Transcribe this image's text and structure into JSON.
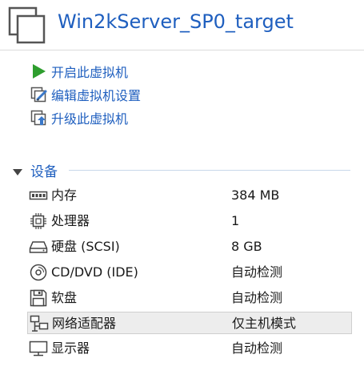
{
  "vm": {
    "title": "Win2kServer_SP0_target"
  },
  "actions": [
    {
      "label": "开启此虚拟机",
      "icon": "play-icon"
    },
    {
      "label": "编辑虚拟机设置",
      "icon": "edit-settings-icon"
    },
    {
      "label": "升级此虚拟机",
      "icon": "upgrade-icon"
    }
  ],
  "devices": {
    "header": "设备",
    "items": [
      {
        "name": "内存",
        "value": "384 MB",
        "icon": "memory-icon"
      },
      {
        "name": "处理器",
        "value": "1",
        "icon": "processor-icon"
      },
      {
        "name": "硬盘 (SCSI)",
        "value": "8 GB",
        "icon": "hard-disk-icon"
      },
      {
        "name": "CD/DVD (IDE)",
        "value": "自动检测",
        "icon": "cd-dvd-icon"
      },
      {
        "name": "软盘",
        "value": "自动检测",
        "icon": "floppy-icon"
      },
      {
        "name": "网络适配器",
        "value": "仅主机模式",
        "icon": "network-adapter-icon"
      },
      {
        "name": "显示器",
        "value": "自动检测",
        "icon": "display-icon"
      }
    ]
  },
  "colors": {
    "link": "#1f5fbf",
    "play_green": "#2e9e2e",
    "selected_bg": "#ededed"
  }
}
